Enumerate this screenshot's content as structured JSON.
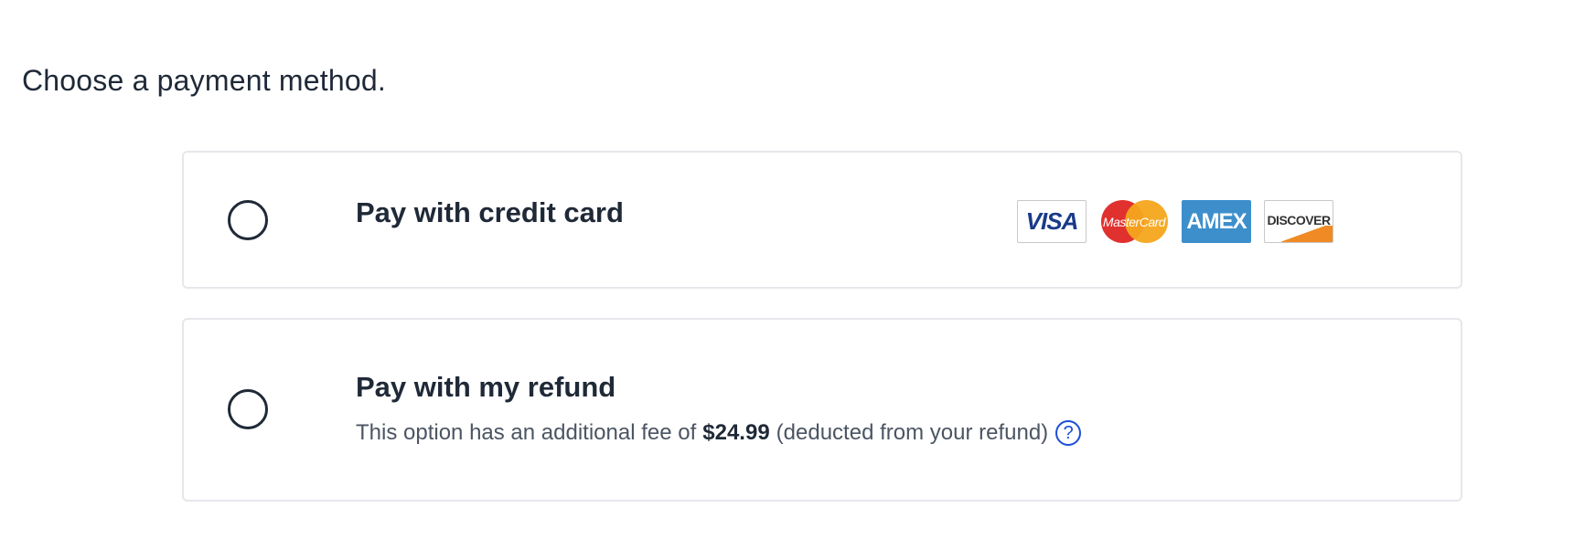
{
  "heading": "Choose a payment method.",
  "options": [
    {
      "title": "Pay with credit card",
      "selected": false,
      "card_logos": [
        "VISA",
        "MasterCard",
        "AMEX",
        "DISCOVER"
      ]
    },
    {
      "title": "Pay with my refund",
      "selected": false,
      "desc_before": "This option has an additional fee of",
      "fee": "$24.99",
      "desc_after": "(deducted from your refund)",
      "help_icon": "?"
    }
  ],
  "colors": {
    "text": "#1f2937",
    "muted": "#4b5563",
    "border": "#e5e7eb",
    "help_accent": "#1d4ed8"
  }
}
